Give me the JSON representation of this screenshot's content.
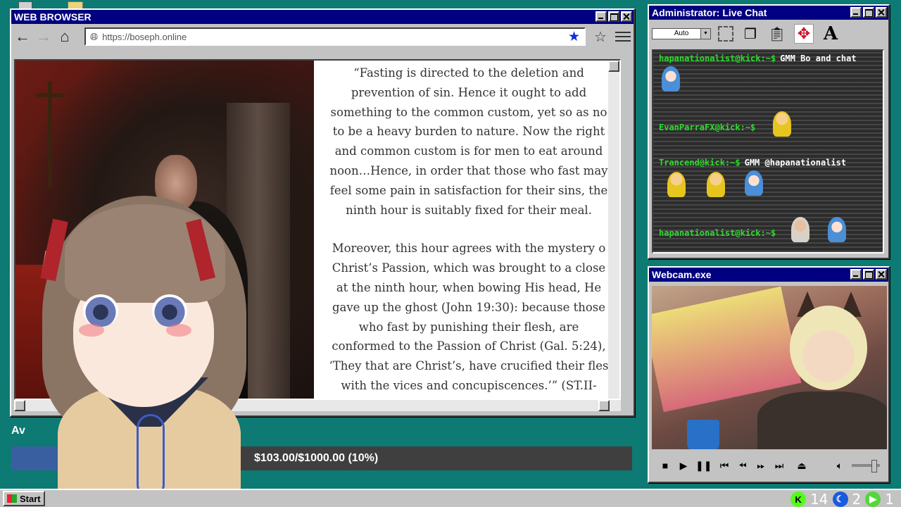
{
  "browser": {
    "title": "WEB BROWSER",
    "url": "https://boseph.online",
    "quote_paragraphs": [
      [
        "“Fasting is directed to the deletion and",
        "prevention of sin. Hence it ought to add",
        "something to the common custom, yet so as no",
        "to be a heavy burden to nature. Now the right",
        "and common custom is for men to eat around",
        "noon…Hence, in order that those who fast may",
        "feel some pain in satisfaction for their sins, the",
        "ninth hour is suitably fixed for their meal."
      ],
      [
        "Moreover, this hour agrees with the mystery o",
        "Christ’s Passion, which was brought to a close",
        "at the ninth hour, when bowing His head, He",
        "gave up the ghost (John 19:30): because those",
        "who fast by punishing their flesh, are",
        "conformed to the Passion of Christ (Gal. 5:24),",
        "‘They that are Christ’s, have crucified their fles",
        "with the vices and concupiscences.’” (ST.II-"
      ]
    ]
  },
  "chat": {
    "title": "Administrator: Live Chat",
    "font_select": "Auto",
    "messages": [
      {
        "user": "hapanationalist@kick:~$",
        "text": "GMM Bo and chat"
      },
      {
        "user": "EvanParraFX@kick:~$",
        "text": ""
      },
      {
        "user": "Trancend@kick:~$",
        "text": "GMM @hapanationalist"
      },
      {
        "user": "hapanationalist@kick:~$",
        "text": ""
      }
    ]
  },
  "webcam": {
    "title": "Webcam.exe"
  },
  "donation": {
    "label": "Av",
    "text": "$103.00/$1000.00 (10%)",
    "progress_fraction": 0.103
  },
  "taskbar": {
    "start_label": "Start",
    "tray_counts": [
      "14",
      "2",
      "1"
    ]
  },
  "colors": {
    "desktop": "#0d7a73",
    "titlebar": "#000080",
    "chat_user": "#2bdc2b",
    "bookmark_star": "#0c2fd6"
  }
}
